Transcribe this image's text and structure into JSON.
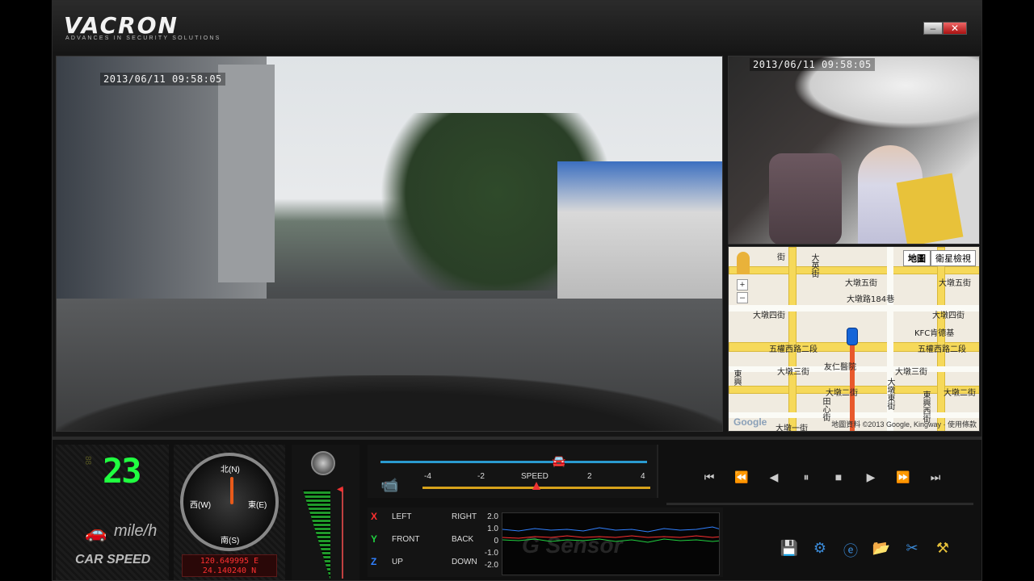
{
  "app": {
    "logo": "VACRON",
    "tagline": "ADVANCES IN SECURITY SOLUTIONS",
    "window_controls": [
      "–",
      "✕"
    ]
  },
  "video_main": {
    "timestamp": "2013/06/11 09:58:05"
  },
  "video_cabin": {
    "timestamp": "2013/06/11 09:58:05"
  },
  "map": {
    "buttons": [
      "地圖",
      "衛星檢視"
    ],
    "selected_button": "地圖",
    "labels": [
      "街",
      "大英街",
      "大墩五街",
      "大墩路184巷",
      "大墩五街",
      "大墩四街",
      "大墩四街",
      "KFC肯德基",
      "五權西路二段",
      "五權西路二段",
      "大墩三街",
      "大墩三街",
      "友仁醫院",
      "大墩二街",
      "大墩二街",
      "大墩一街",
      "田心街",
      "大墩東街",
      "東興西街",
      "東興"
    ],
    "copyright": "地圖資料 ©2013 Google, Kingway · 使用條款",
    "google_logo": "Google",
    "route_color": "#e8592c",
    "marker_color": "#1565d8"
  },
  "speed": {
    "value": "23",
    "unit": "mile/h",
    "label": "CAR SPEED",
    "digit_color": "#20ff40"
  },
  "compass": {
    "north": "北(N)",
    "south": "南(S)",
    "east": "東(E)",
    "west": "西(W)",
    "gps_lat": "120.649995 E",
    "gps_lon": "24.140240 N"
  },
  "speedbar": {
    "title": "SPEED",
    "scale": [
      "-4",
      "-2",
      "",
      "2",
      "4"
    ]
  },
  "gsensor": {
    "watermark": "G Sensor",
    "axes": [
      {
        "letter": "X",
        "a": "LEFT",
        "b": "RIGHT",
        "color": "#ff3030"
      },
      {
        "letter": "Y",
        "a": "FRONT",
        "b": "BACK",
        "color": "#20d040"
      },
      {
        "letter": "Z",
        "a": "UP",
        "b": "DOWN",
        "color": "#3080ff"
      }
    ],
    "scale": [
      "2.0",
      "1.0",
      "0",
      "-1.0",
      "-2.0"
    ]
  },
  "controls": [
    "skip-start",
    "step-back",
    "play-back",
    "pause",
    "stop",
    "play",
    "step-forward",
    "skip-end"
  ],
  "tools": [
    "save",
    "settings",
    "browser",
    "open-folder",
    "snip",
    "tools"
  ]
}
